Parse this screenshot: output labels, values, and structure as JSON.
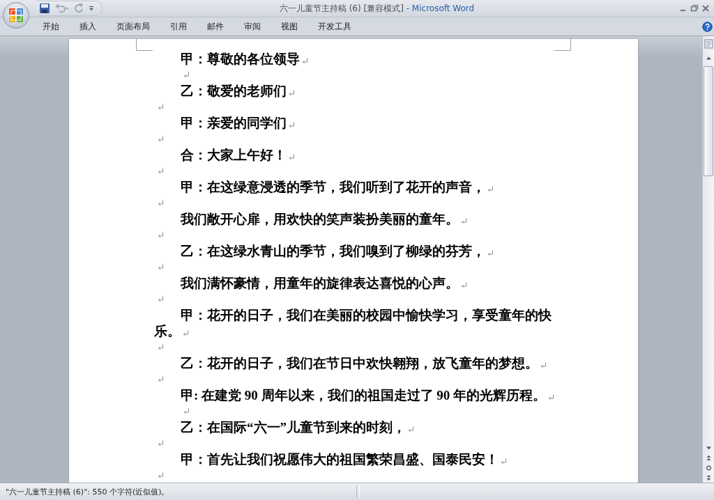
{
  "window": {
    "title": "六一儿童节主持稿 (6) [兼容模式]",
    "app_name": "- Microsoft Word"
  },
  "ribbon_tabs": [
    {
      "label": "开始"
    },
    {
      "label": "插入"
    },
    {
      "label": "页面布局"
    },
    {
      "label": "引用"
    },
    {
      "label": "邮件"
    },
    {
      "label": "审阅"
    },
    {
      "label": "视图"
    },
    {
      "label": "开发工具"
    }
  ],
  "document": {
    "paragraphs": [
      {
        "kind": "text",
        "text": "甲：尊敬的各位领导"
      },
      {
        "kind": "indent"
      },
      {
        "kind": "text",
        "text": "乙：敬爱的老师们"
      },
      {
        "kind": "blank"
      },
      {
        "kind": "text",
        "text": "甲：亲爱的同学们"
      },
      {
        "kind": "blank"
      },
      {
        "kind": "text",
        "text": "合：大家上午好！"
      },
      {
        "kind": "blank"
      },
      {
        "kind": "text",
        "text": "甲：在这绿意浸透的季节，我们听到了花开的声音，"
      },
      {
        "kind": "blank"
      },
      {
        "kind": "text",
        "text": "我们敞开心扉，用欢快的笑声装扮美丽的童年。"
      },
      {
        "kind": "blank"
      },
      {
        "kind": "text",
        "text": "乙：在这绿水青山的季节，我们嗅到了柳绿的芬芳，"
      },
      {
        "kind": "blank"
      },
      {
        "kind": "text",
        "text": "我们满怀豪情，用童年的旋律表达喜悦的心声。"
      },
      {
        "kind": "blank"
      },
      {
        "kind": "text",
        "lines": [
          "甲：花开的日子，我们在美丽的校园中愉快学习，享受童年的快",
          "乐。"
        ]
      },
      {
        "kind": "blank"
      },
      {
        "kind": "text",
        "text": "乙：花开的日子，我们在节日中欢快翱翔，放飞童年的梦想。"
      },
      {
        "kind": "blank"
      },
      {
        "kind": "text",
        "text": "甲: 在建党 90 周年以来，我们的祖国走过了 90 年的光辉历程。"
      },
      {
        "kind": "indent"
      },
      {
        "kind": "text",
        "text": "乙：在国际“六一”儿童节到来的时刻，"
      },
      {
        "kind": "blank"
      },
      {
        "kind": "text",
        "text": "甲：首先让我们祝愿伟大的祖国繁荣昌盛、国泰民安！"
      },
      {
        "kind": "blank"
      }
    ]
  },
  "status_bar": {
    "text": "\"六一儿童节主持稿 (6)\": 550 个字符(近似值)。"
  }
}
